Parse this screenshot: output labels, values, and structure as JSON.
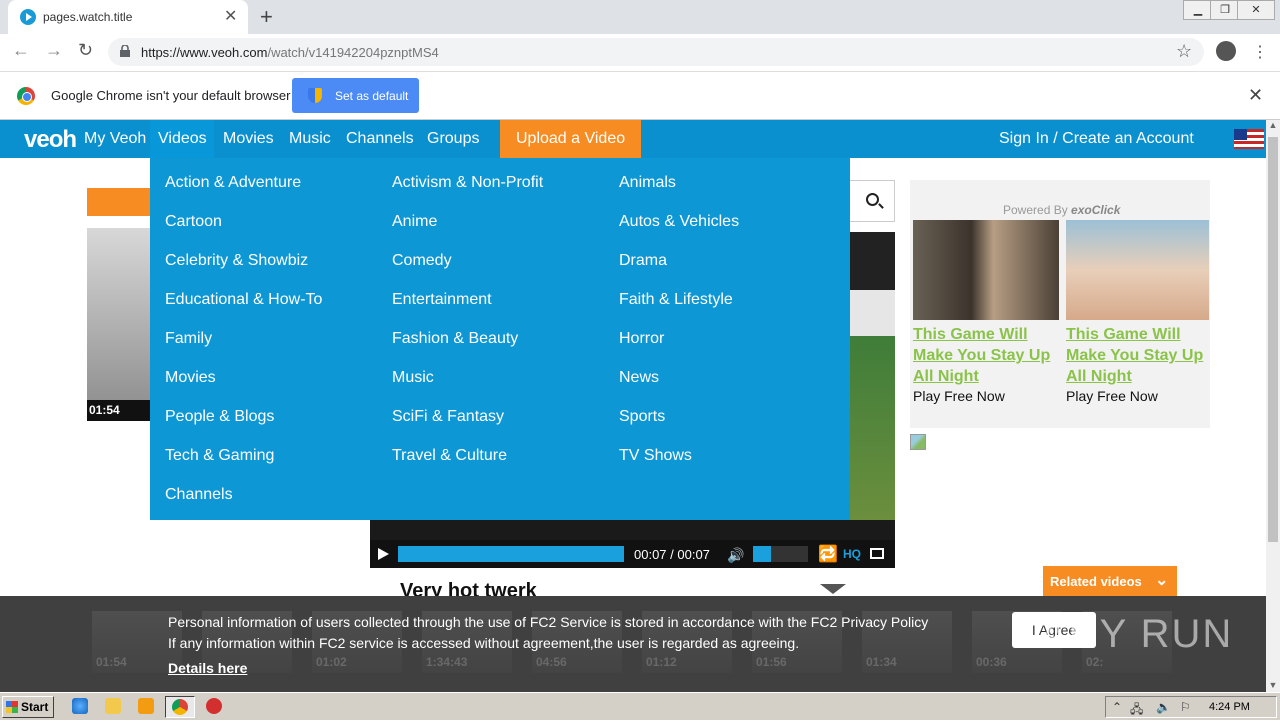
{
  "browser": {
    "tab_title": "pages.watch.title",
    "url_host": "https://www.veoh.com",
    "url_path": "/watch/v141942204pznptMS4",
    "infobar_text": "Google Chrome isn't your default browser",
    "set_default_label": "Set as default"
  },
  "veoh_nav": {
    "logo": "veoh",
    "items": [
      "My Veoh",
      "Videos",
      "Movies",
      "Music",
      "Channels",
      "Groups"
    ],
    "upload": "Upload a Video",
    "signin": "Sign In / Create an Account"
  },
  "menu": {
    "col1": [
      "Action & Adventure",
      "Cartoon",
      "Celebrity & Showbiz",
      "Educational & How-To",
      "Family",
      "Movies",
      "People & Blogs",
      "Tech & Gaming",
      "Channels"
    ],
    "col2": [
      "Activism & Non-Profit",
      "Anime",
      "Comedy",
      "Entertainment",
      "Fashion & Beauty",
      "Music",
      "SciFi & Fantasy",
      "Travel & Culture"
    ],
    "col3": [
      "Animals",
      "Autos & Vehicles",
      "Drama",
      "Faith & Lifestyle",
      "Horror",
      "News",
      "Sports",
      "TV Shows"
    ]
  },
  "player": {
    "time": "00:07 / 00:07",
    "hq": "HQ",
    "progress": 1.0,
    "volume": 0.33,
    "title": "Very hot twerk",
    "left_thumb_duration": "01:54"
  },
  "ad": {
    "powered_prefix": "Powered By",
    "powered_brand": "exoClick",
    "items": [
      {
        "link": "This Game Will Make You Stay Up All Night",
        "sub": "Play Free Now"
      },
      {
        "link": "This Game Will Make You Stay Up All Night",
        "sub": "Play Free Now"
      }
    ]
  },
  "related": {
    "label": "Related videos"
  },
  "strip_durations": [
    "01:54",
    "",
    "01:02",
    "1:34:43",
    "04:56",
    "01:12",
    "01:56",
    "01:34",
    "00:36",
    "02:"
  ],
  "consent": {
    "line1": "Personal information of users collected through the use of FC2 Service is stored in accordance with the FC2 Privacy Policy",
    "line2": "If any information within FC2 service is accessed without agreement,the user is regarded as agreeing.",
    "details": "Details here",
    "agree": "I Agree"
  },
  "watermark": "ANY RUN",
  "taskbar": {
    "start": "Start",
    "clock": "4:24 PM"
  },
  "colors": {
    "veoh_blue": "#0a90cf",
    "veoh_orange": "#f78c22",
    "ad_green": "#8bc34a"
  }
}
